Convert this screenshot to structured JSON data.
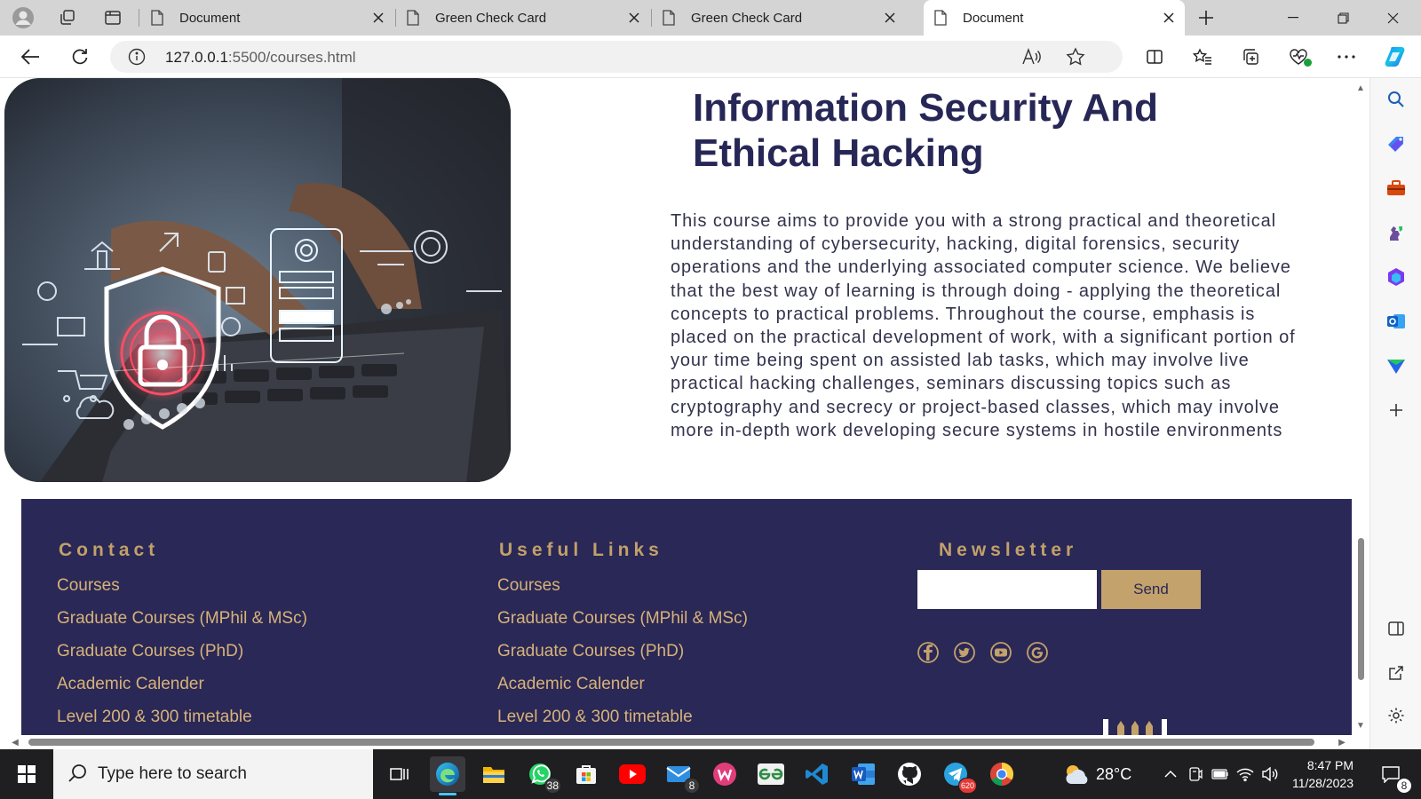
{
  "browser": {
    "tabs": [
      {
        "label": "Document",
        "active": false
      },
      {
        "label": "Green Check Card",
        "active": false
      },
      {
        "label": "Green Check Card",
        "active": false
      },
      {
        "label": "Document",
        "active": true
      }
    ],
    "url_host": "127.0.0.1",
    "url_path": ":5500/courses.html"
  },
  "page": {
    "course": {
      "title": "Information Security And Ethical Hacking",
      "description": "This course aims to provide you with a strong practical and theoretical understanding of cybersecurity, hacking, digital forensics, security operations and the underlying associated computer science. We believe that the best way of learning is through doing - applying the theoretical concepts to practical problems. Throughout the course, emphasis is placed on the practical development of work, with a significant portion of your time being spent on assisted lab tasks, which may involve live practical hacking challenges, seminars discussing topics such as cryptography and secrecy or project-based classes, which may involve more in-depth work developing secure systems in hostile environments"
    },
    "footer": {
      "contact": {
        "heading": "Contact",
        "links": [
          "Courses",
          "Graduate Courses (MPhil & MSc)",
          "Graduate Courses (PhD)",
          "Academic Calender",
          "Level 200 & 300 timetable"
        ]
      },
      "useful_links": {
        "heading": "Useful Links",
        "links": [
          "Courses",
          "Graduate Courses (MPhil & MSc)",
          "Graduate Courses (PhD)",
          "Academic Calender",
          "Level 200 & 300 timetable"
        ]
      },
      "newsletter": {
        "heading": "Newsletter",
        "input_value": "",
        "button_label": "Send"
      },
      "social_icons": [
        "facebook-icon",
        "twitter-icon",
        "youtube-icon",
        "google-icon"
      ]
    }
  },
  "taskbar": {
    "search_placeholder": "Type here to search",
    "whatsapp_badge": "38",
    "mail_badge": "8",
    "telegram_badge": "620",
    "weather": "28°C",
    "time": "8:47 PM",
    "date": "11/28/2023",
    "notifications": "8"
  },
  "colors": {
    "footer_bg": "#2a2856",
    "footer_gold": "#c4a26c",
    "title_navy": "#272757"
  }
}
